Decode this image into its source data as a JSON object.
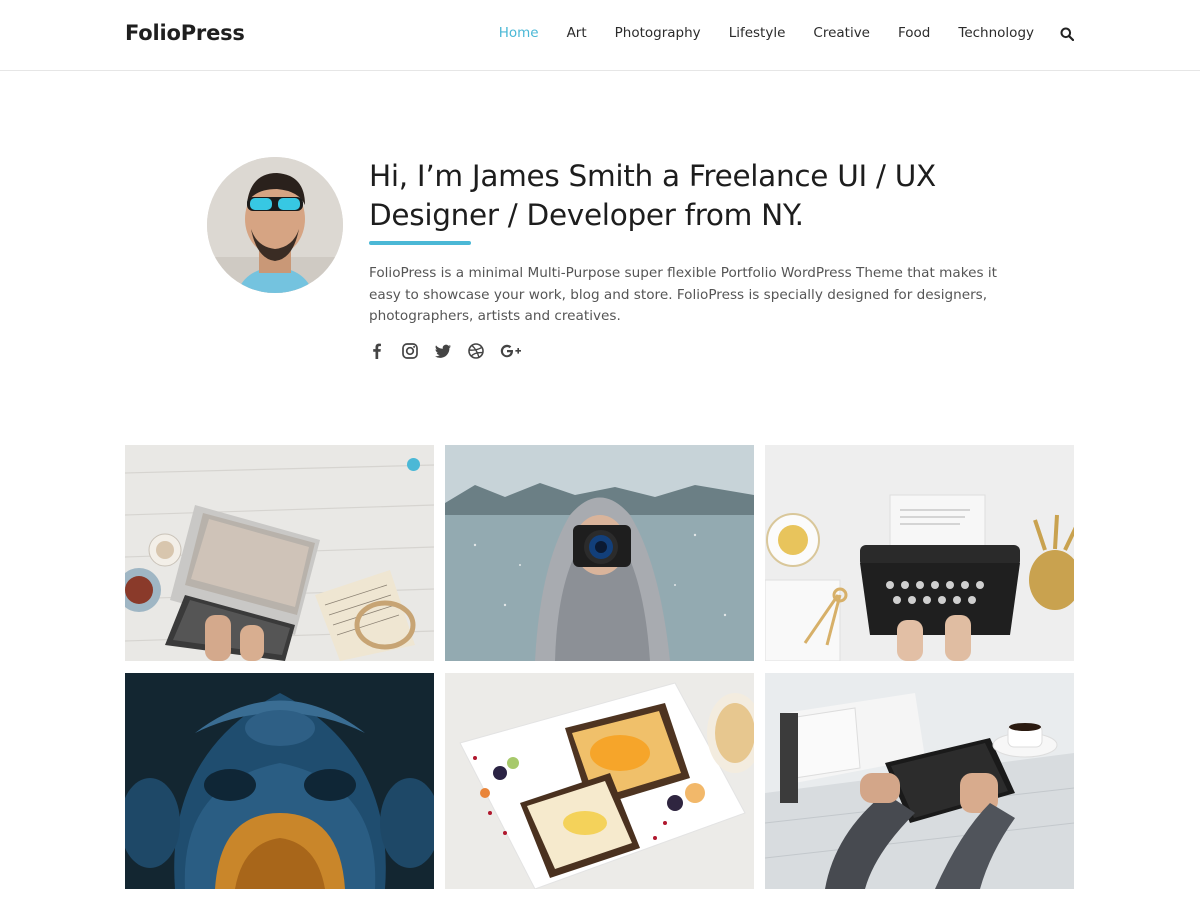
{
  "header": {
    "logo": "FolioPress",
    "nav": [
      {
        "label": "Home",
        "active": true
      },
      {
        "label": "Art",
        "active": false
      },
      {
        "label": "Photography",
        "active": false
      },
      {
        "label": "Lifestyle",
        "active": false
      },
      {
        "label": "Creative",
        "active": false
      },
      {
        "label": "Food",
        "active": false
      },
      {
        "label": "Technology",
        "active": false
      }
    ],
    "search_icon": "search-icon"
  },
  "intro": {
    "headline": "Hi, I’m James Smith a Freelance UI / UX Designer / Developer from NY.",
    "text": "FolioPress is a minimal Multi-Purpose super flexible Portfolio WordPress Theme that makes it easy to showcase your work, blog and store. FolioPress is specially designed for designers, photographers, artists and creatives.",
    "social_icons": [
      "facebook-icon",
      "instagram-icon",
      "twitter-icon",
      "dribbble-icon",
      "google-plus-icon"
    ]
  },
  "portfolio": {
    "tiles": [
      {
        "subject": "laptop-workspace"
      },
      {
        "subject": "photographer-in-snow"
      },
      {
        "subject": "typewriter"
      },
      {
        "subject": "ganesha-statue"
      },
      {
        "subject": "toast-plate"
      },
      {
        "subject": "tablet-coffee"
      }
    ]
  },
  "colors": {
    "accent": "#4bb8d6",
    "text": "#1d1d1d",
    "muted": "#555555",
    "border": "#e6e6e6"
  }
}
